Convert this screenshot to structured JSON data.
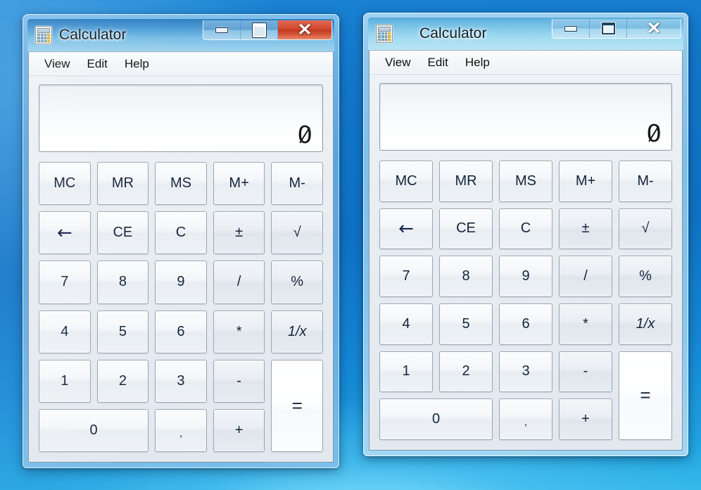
{
  "desktop": {
    "background_top": "#1277cb",
    "background_bottom": "#35b9ea"
  },
  "windows": [
    {
      "id": "calculator-window-1",
      "title": "Calculator",
      "state": "inactive",
      "icon": "calculator-icon",
      "controls": {
        "minimize_label": "",
        "maximize_label": "",
        "close_label": "✕",
        "minimize_name": "minimize-button",
        "maximize_name": "maximize-button",
        "close_name": "close-button"
      },
      "menu": [
        "View",
        "Edit",
        "Help"
      ],
      "display": {
        "value": "0"
      },
      "keys": [
        "MC",
        "MR",
        "MS",
        "M+",
        "M-",
        "←",
        "CE",
        "C",
        "±",
        "√",
        "7",
        "8",
        "9",
        "/",
        "%",
        "4",
        "5",
        "6",
        "*",
        "1/x",
        "1",
        "2",
        "3",
        "-",
        "=",
        "0",
        ",",
        "+"
      ]
    },
    {
      "id": "calculator-window-2",
      "title": "Calculator",
      "state": "active",
      "icon": "calculator-icon",
      "controls": {
        "minimize_label": "",
        "maximize_label": "",
        "close_label": "✕",
        "minimize_name": "minimize-button",
        "maximize_name": "restore-button",
        "close_name": "close-button"
      },
      "menu": [
        "View",
        "Edit",
        "Help"
      ],
      "display": {
        "value": "0"
      },
      "keys": [
        "MC",
        "MR",
        "MS",
        "M+",
        "M-",
        "←",
        "CE",
        "C",
        "±",
        "√",
        "7",
        "8",
        "9",
        "/",
        "%",
        "4",
        "5",
        "6",
        "*",
        "1/x",
        "1",
        "2",
        "3",
        "-",
        "=",
        "0",
        ",",
        "+"
      ]
    }
  ]
}
